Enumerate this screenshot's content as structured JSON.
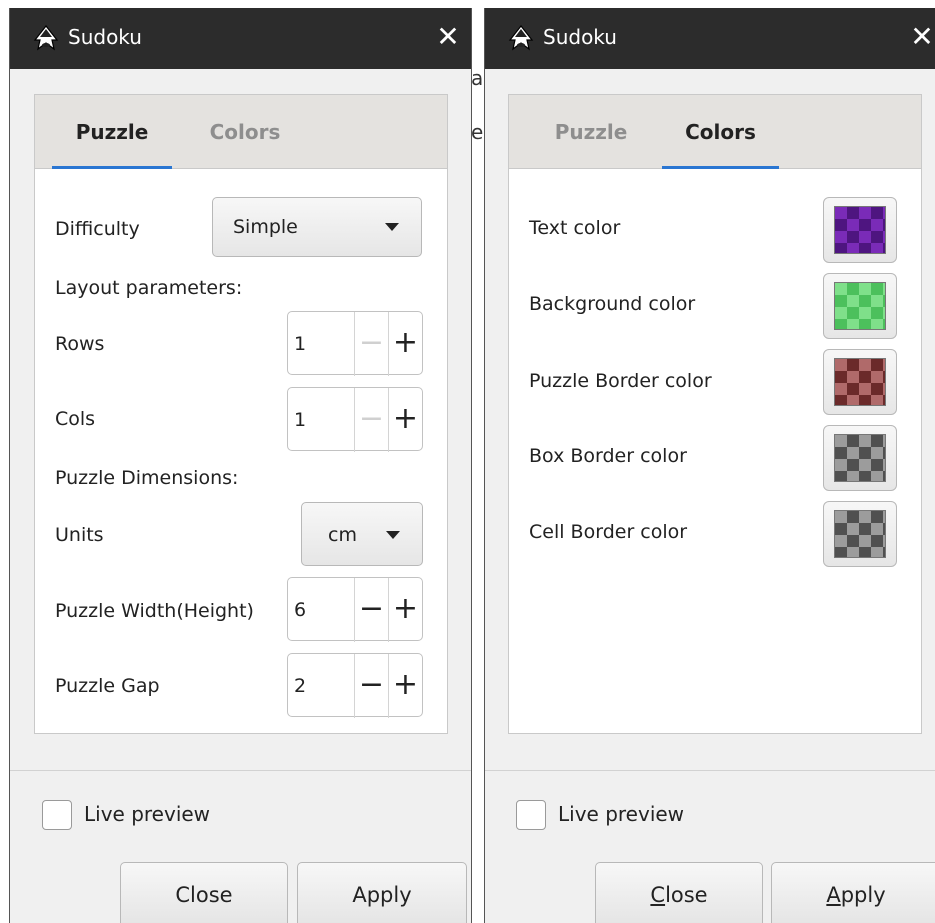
{
  "background_text": [
    "a",
    "e"
  ],
  "dialogs": [
    {
      "title": "Sudoku",
      "close_glyph": "✕",
      "tabs": [
        {
          "label": "Puzzle",
          "active": true
        },
        {
          "label": "Colors",
          "active": false
        }
      ],
      "puzzle": {
        "difficulty_label": "Difficulty",
        "difficulty_value": "Simple",
        "layout_header": "Layout parameters:",
        "rows_label": "Rows",
        "rows_value": "1",
        "cols_label": "Cols",
        "cols_value": "1",
        "dimensions_header": "Puzzle Dimensions:",
        "units_label": "Units",
        "units_value": "cm",
        "width_label": "Puzzle Width(Height)",
        "width_value": "6",
        "gap_label": "Puzzle Gap",
        "gap_value": "2"
      },
      "live_preview_label": "Live preview",
      "close_button": "Close",
      "apply_button": "Apply"
    },
    {
      "title": "Sudoku",
      "close_glyph": "✕",
      "tabs": [
        {
          "label": "Puzzle",
          "active": false
        },
        {
          "label": "Colors",
          "active": true
        }
      ],
      "colors": [
        {
          "label": "Text color",
          "swatch": "#7a2bb8",
          "swatch_dark": "#4e1580"
        },
        {
          "label": "Background color",
          "swatch": "#7fe08a",
          "swatch_dark": "#4cc05c"
        },
        {
          "label": "Puzzle Border color",
          "swatch": "#b06a6a",
          "swatch_dark": "#6b2a2a"
        },
        {
          "label": "Box Border color",
          "swatch": "#9c9c9c",
          "swatch_dark": "#505050"
        },
        {
          "label": "Cell Border color",
          "swatch": "#9c9c9c",
          "swatch_dark": "#505050"
        }
      ],
      "live_preview_label": "Live preview",
      "close_button_mnemonic": "C",
      "close_button_rest": "lose",
      "apply_button_mnemonic": "A",
      "apply_button_rest": "pply"
    }
  ],
  "colors": {
    "titlebar": "#2c2c2c",
    "tab_accent": "#2a76d2",
    "dialog_bg": "#f0f0f0"
  },
  "icons": {
    "app": "inkscape-icon",
    "close": "close-icon",
    "dropdown": "caret-down-icon",
    "minus": "minus-icon",
    "plus": "plus-icon"
  }
}
